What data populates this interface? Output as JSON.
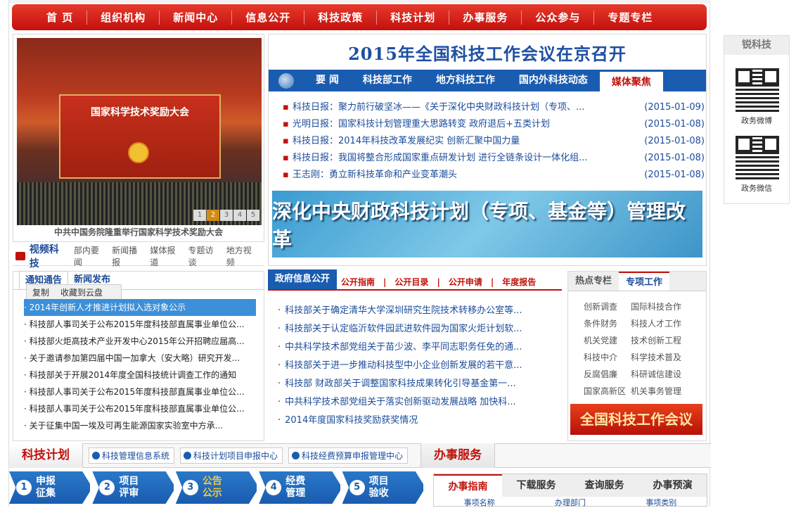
{
  "nav": [
    "首 页",
    "组织机构",
    "新闻中心",
    "信息公开",
    "科技政策",
    "科技计划",
    "办事服务",
    "公众参与",
    "专题专栏"
  ],
  "slider": {
    "banner_text": "国家科学技术奖励大会",
    "caption": "中共中国务院隆重举行国家科学技术奖励大会",
    "dots": [
      "1",
      "2",
      "3",
      "4",
      "5"
    ]
  },
  "video": {
    "title": "视频科技",
    "items": [
      "部内要闻",
      "新闻播报",
      "媒体报道",
      "专题访谈",
      "地方视频"
    ]
  },
  "headline": "2015年全国科技工作会议在京召开",
  "tabs1": [
    "要  闻",
    "科技部工作",
    "地方科技工作",
    "国内外科技动态",
    "媒体聚焦"
  ],
  "news1": [
    {
      "text": "科技日报：聚力前行破坚冰——《关于深化中央财政科技计划（专项、...",
      "date": "(2015-01-09)"
    },
    {
      "text": "光明日报：国家科技计划管理重大思路转变 政府退后+五类计划",
      "date": "(2015-01-08)"
    },
    {
      "text": "科技日报：2014年科技改革发展纪实 创新汇聚中国力量",
      "date": "(2015-01-08)"
    },
    {
      "text": "科技日报：我国将整合形成国家重点研发计划 进行全链条设计一体化组...",
      "date": "(2015-01-08)"
    },
    {
      "text": "王志刚：勇立新科技革命和产业变革潮头",
      "date": "(2015-01-08)"
    }
  ],
  "banner": "深化中央财政科技计划（专项、基金等）管理改革",
  "notice": {
    "tabs": [
      "通知通告",
      "新闻发布"
    ],
    "context_menu": [
      "复制",
      "收藏到云盘"
    ],
    "items": [
      "· 2014年创新人才推进计划拟入选对象公示",
      "· 科技部人事司关于公布2015年度科技部直属事业单位公...",
      "· 科技部火炬高技术产业开发中心2015年公开招聘应届高...",
      "· 关于邀请参加第四届中国一加拿大（安大略）研究开发...",
      "· 科技部关于开展2014年度全国科技统计调查工作的通知",
      "· 科技部人事司关于公布2015年度科技部直属事业单位公...",
      "· 科技部人事司关于公布2015年度科技部直属事业单位公...",
      "· 关于征集中国一埃及可再生能源国家实验室中方承..."
    ]
  },
  "gov": {
    "tab": "政府信息公开",
    "links": [
      "公开指南",
      "|",
      "公开目录",
      "|",
      "公开申请",
      "|",
      "年度报告"
    ],
    "items": [
      "科技部关于确定清华大学深圳研究生院技术转移办公室等...",
      "科技部关于认定临沂软件园武进软件园为国家火炬计划软...",
      "中共科学技术部党组关于苗少波、李平同志职务任免的通...",
      "科技部关于进一步推动科技型中小企业创新发展的若干意...",
      "科技部 财政部关于调整国家科技成果转化引导基金第一...",
      "中共科学技术部党组关于落实创新驱动发展战略 加快科...",
      "2014年度国家科技奖励获奖情况"
    ]
  },
  "hot": {
    "tabs": [
      "热点专栏",
      "专项工作"
    ],
    "grid": [
      "创新调查",
      "国际科技合作",
      "条件财务",
      "科技人才工作",
      "机关党建",
      "技术创新工程",
      "科技中介",
      "科学技术普及",
      "反腐倡廉",
      "科研诚信建设",
      "国家高新区",
      "机关事务管理"
    ],
    "banner": "全国科技工作会议"
  },
  "bar3": {
    "label": "科技计划",
    "buttons": [
      "科技管理信息系统",
      "科技计划项目申报中心",
      "科技经费预算申报管理中心"
    ],
    "label2": "办事服务"
  },
  "steps": [
    {
      "n": "1",
      "label": "申报征集"
    },
    {
      "n": "2",
      "label": "项目评审"
    },
    {
      "n": "3",
      "label": "公告公示"
    },
    {
      "n": "4",
      "label": "经费管理"
    },
    {
      "n": "5",
      "label": "项目验收"
    }
  ],
  "service": {
    "tabs": [
      "办事指南",
      "下载服务",
      "查询服务",
      "办事预演"
    ],
    "cols": [
      "事项名称",
      "办理部门",
      "事项类别"
    ]
  },
  "side": {
    "title": "锐科技",
    "qr1": "政务微博",
    "qr2": "政务微信"
  }
}
